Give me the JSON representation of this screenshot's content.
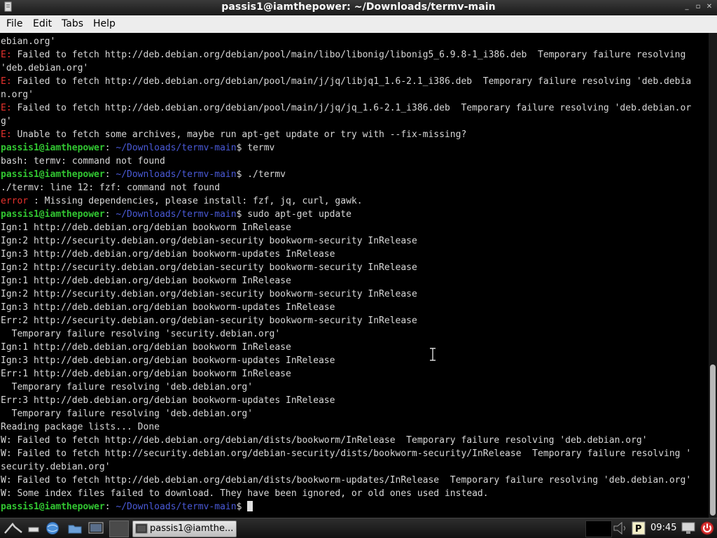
{
  "window": {
    "title": "passis1@iamthepower: ~/Downloads/termv-main",
    "buttons": [
      "minimize",
      "maximize",
      "close"
    ]
  },
  "menu": {
    "items": [
      "File",
      "Edit",
      "Tabs",
      "Help"
    ]
  },
  "terminal": {
    "lines": [
      [
        {
          "t": "ebian.org'"
        }
      ],
      [
        {
          "t": "E:",
          "c": "red"
        },
        {
          "t": " Failed to fetch http://deb.debian.org/debian/pool/main/libo/libonig/libonig5_6.9.8-1_i386.deb  Temporary failure resolving"
        }
      ],
      [
        {
          "t": "'deb.debian.org'"
        }
      ],
      [
        {
          "t": "E:",
          "c": "red"
        },
        {
          "t": " Failed to fetch http://deb.debian.org/debian/pool/main/j/jq/libjq1_1.6-2.1_i386.deb  Temporary failure resolving 'deb.debia"
        }
      ],
      [
        {
          "t": "n.org'"
        }
      ],
      [
        {
          "t": "E:",
          "c": "red"
        },
        {
          "t": " Failed to fetch http://deb.debian.org/debian/pool/main/j/jq/jq_1.6-2.1_i386.deb  Temporary failure resolving 'deb.debian.or"
        }
      ],
      [
        {
          "t": "g'"
        }
      ],
      [
        {
          "t": "E:",
          "c": "red"
        },
        {
          "t": " Unable to fetch some archives, maybe run apt-get update or try with --fix-missing?"
        }
      ],
      [
        {
          "t": "passis1@iamthepower",
          "c": "green"
        },
        {
          "t": ": "
        },
        {
          "t": "~/Downloads/termv-main",
          "c": "blue"
        },
        {
          "t": "$ termv"
        }
      ],
      [
        {
          "t": "bash: termv: command not found"
        }
      ],
      [
        {
          "t": "passis1@iamthepower",
          "c": "green"
        },
        {
          "t": ": "
        },
        {
          "t": "~/Downloads/termv-main",
          "c": "blue"
        },
        {
          "t": "$ ./termv"
        }
      ],
      [
        {
          "t": "./termv: line 12: fzf: command not found"
        }
      ],
      [
        {
          "t": "error",
          "c": "red"
        },
        {
          "t": " : Missing dependencies, please install: fzf, jq, curl, gawk."
        }
      ],
      [
        {
          "t": "passis1@iamthepower",
          "c": "green"
        },
        {
          "t": ": "
        },
        {
          "t": "~/Downloads/termv-main",
          "c": "blue"
        },
        {
          "t": "$ sudo apt-get update"
        }
      ],
      [
        {
          "t": "Ign:1 http://deb.debian.org/debian bookworm InRelease"
        }
      ],
      [
        {
          "t": "Ign:2 http://security.debian.org/debian-security bookworm-security InRelease"
        }
      ],
      [
        {
          "t": "Ign:3 http://deb.debian.org/debian bookworm-updates InRelease"
        }
      ],
      [
        {
          "t": "Ign:2 http://security.debian.org/debian-security bookworm-security InRelease"
        }
      ],
      [
        {
          "t": "Ign:1 http://deb.debian.org/debian bookworm InRelease"
        }
      ],
      [
        {
          "t": "Ign:2 http://security.debian.org/debian-security bookworm-security InRelease"
        }
      ],
      [
        {
          "t": "Ign:3 http://deb.debian.org/debian bookworm-updates InRelease"
        }
      ],
      [
        {
          "t": "Err:2 http://security.debian.org/debian-security bookworm-security InRelease"
        }
      ],
      [
        {
          "t": "  Temporary failure resolving 'security.debian.org'"
        }
      ],
      [
        {
          "t": "Ign:1 http://deb.debian.org/debian bookworm InRelease"
        }
      ],
      [
        {
          "t": "Ign:3 http://deb.debian.org/debian bookworm-updates InRelease"
        }
      ],
      [
        {
          "t": "Err:1 http://deb.debian.org/debian bookworm InRelease"
        }
      ],
      [
        {
          "t": "  Temporary failure resolving 'deb.debian.org'"
        }
      ],
      [
        {
          "t": "Err:3 http://deb.debian.org/debian bookworm-updates InRelease"
        }
      ],
      [
        {
          "t": "  Temporary failure resolving 'deb.debian.org'"
        }
      ],
      [
        {
          "t": "Reading package lists... Done"
        }
      ],
      [
        {
          "t": "W: Failed to fetch http://deb.debian.org/debian/dists/bookworm/InRelease  Temporary failure resolving 'deb.debian.org'"
        }
      ],
      [
        {
          "t": "W: Failed to fetch http://security.debian.org/debian-security/dists/bookworm-security/InRelease  Temporary failure resolving '"
        }
      ],
      [
        {
          "t": "security.debian.org'"
        }
      ],
      [
        {
          "t": "W: Failed to fetch http://deb.debian.org/debian/dists/bookworm-updates/InRelease  Temporary failure resolving 'deb.debian.org'"
        }
      ],
      [
        {
          "t": "W: Some index files failed to download. They have been ignored, or old ones used instead."
        }
      ],
      [
        {
          "t": "passis1@iamthepower",
          "c": "green"
        },
        {
          "t": ": "
        },
        {
          "t": "~/Downloads/termv-main",
          "c": "blue"
        },
        {
          "t": "$ "
        },
        {
          "cursor": true
        }
      ]
    ],
    "colors": {
      "red": "#e8322d",
      "green": "#32c832",
      "blue": "#4a5ad8",
      "default": "#d8d8d8"
    }
  },
  "taskbar": {
    "task_label": "passis1@iamthe...",
    "clock": "09:45",
    "icons": [
      "menu-launcher-icon",
      "minimize-all-icon",
      "browser-icon",
      "file-manager-icon",
      "terminal-icon",
      "volume-icon",
      "parcellite-icon",
      "display-icon",
      "power-icon"
    ]
  }
}
